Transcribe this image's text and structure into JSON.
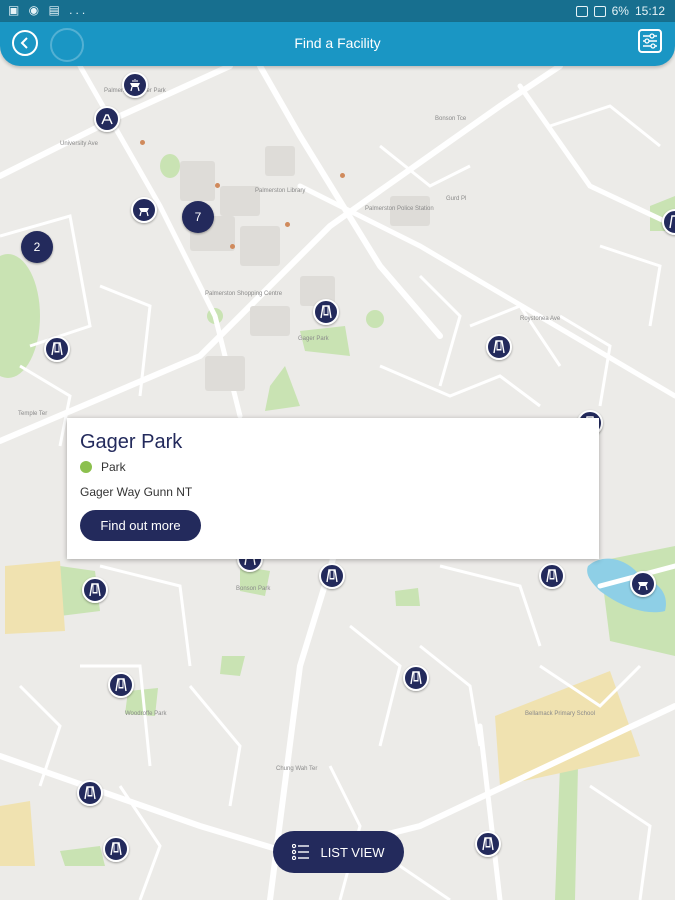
{
  "status_bar": {
    "left": "▣ ◉ ▤ ...",
    "battery": "6%",
    "time": "15:12"
  },
  "header": {
    "title": "Find a Facility"
  },
  "card": {
    "title": "Gager Park",
    "type": "Park",
    "type_color": "#8cc04e",
    "address": "Gager Way Gunn NT",
    "button": "Find out more"
  },
  "list_view": {
    "label": "LIST VIEW"
  },
  "clusters": [
    "7",
    "2"
  ],
  "map_labels": {
    "l1": "Palmerston Water Park",
    "l2": "Palmerston Shopping Centre",
    "l3": "Palmerston Police Station",
    "l4": "Gager Park",
    "l5": "Bonson Park",
    "l6": "Bellamack Primary School",
    "l7": "Woodroffe Park",
    "l8": "Palmerston Library",
    "l9": "Temple Ter",
    "l10": "University Ave",
    "l11": "Chung Wah Ter",
    "l12": "Roystonea Ave",
    "l13": "Bonson Tce",
    "l14": "Gurd Pl"
  },
  "colors": {
    "brand": "#1a96c4",
    "pin": "#232a5c",
    "park": "#c9e3b3",
    "school": "#f0e2b0",
    "water": "#8ecfe6"
  }
}
